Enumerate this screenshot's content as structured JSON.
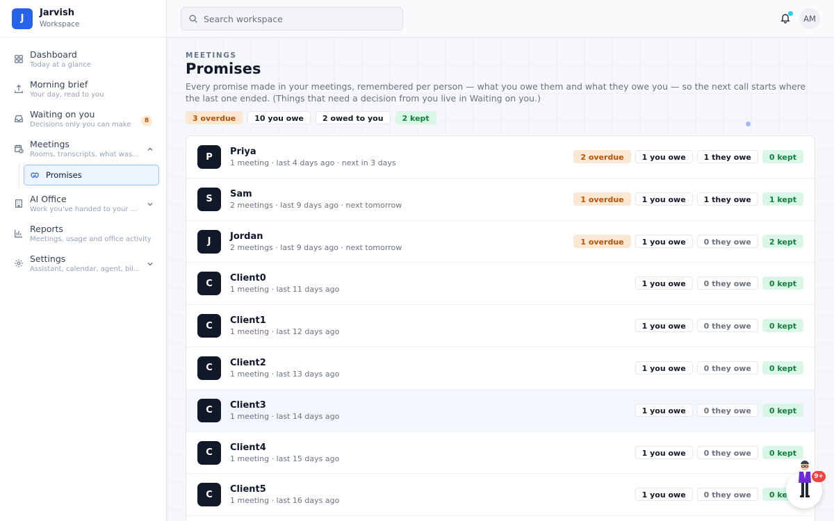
{
  "brand": {
    "initial": "J",
    "name": "Jarvish",
    "subtitle": "Workspace"
  },
  "sidebar": {
    "items": [
      {
        "label": "Dashboard",
        "sub": "Today at a glance",
        "icon": "grid-icon"
      },
      {
        "label": "Morning brief",
        "sub": "Your day, read to you",
        "icon": "upload-icon"
      },
      {
        "label": "Waiting on you",
        "sub": "Decisions only you can make",
        "icon": "inbox-icon",
        "badge": "8"
      },
      {
        "label": "Meetings",
        "sub": "Rooms, transcripts, what was...",
        "icon": "calendar-clock-icon",
        "expanded": true,
        "children": [
          {
            "label": "Promises",
            "icon": "handshake-icon",
            "active": true
          }
        ]
      },
      {
        "label": "AI Office",
        "sub": "Work you've handed to your ...",
        "icon": "building-icon"
      },
      {
        "label": "Reports",
        "sub": "Meetings, usage and office activity",
        "icon": "bar-chart-icon"
      },
      {
        "label": "Settings",
        "sub": "Assistant, calendar, agent, bil...",
        "icon": "gear-icon"
      }
    ]
  },
  "header": {
    "search_placeholder": "Search workspace",
    "avatar_initials": "AM"
  },
  "page": {
    "eyebrow": "MEETINGS",
    "title": "Promises",
    "description": "Every promise made in your meetings, remembered per person — what you owe them and what they owe you — so the next call starts where the last one ended. (Things that need a decision from you live in Waiting on you.)",
    "summary": {
      "overdue": "3 overdue",
      "you_owe": "10 you owe",
      "owed_to_you": "2 owed to you",
      "kept": "2 kept"
    }
  },
  "people": [
    {
      "initial": "P",
      "name": "Priya",
      "meta": "1 meeting · last 4 days ago · next in 3 days",
      "overdue": "2 overdue",
      "you_owe": "1 you owe",
      "they_owe": "1 they owe",
      "kept": "0 kept"
    },
    {
      "initial": "S",
      "name": "Sam",
      "meta": "2 meetings · last 9 days ago · next tomorrow",
      "overdue": "1 overdue",
      "you_owe": "1 you owe",
      "they_owe": "1 they owe",
      "kept": "1 kept"
    },
    {
      "initial": "J",
      "name": "Jordan",
      "meta": "2 meetings · last 9 days ago · next tomorrow",
      "overdue": "1 overdue",
      "you_owe": "1 you owe",
      "they_owe": "0 they owe",
      "kept": "2 kept"
    },
    {
      "initial": "C",
      "name": "Client0",
      "meta": "1 meeting · last 11 days ago",
      "you_owe": "1 you owe",
      "they_owe": "0 they owe",
      "kept": "0 kept"
    },
    {
      "initial": "C",
      "name": "Client1",
      "meta": "1 meeting · last 12 days ago",
      "you_owe": "1 you owe",
      "they_owe": "0 they owe",
      "kept": "0 kept"
    },
    {
      "initial": "C",
      "name": "Client2",
      "meta": "1 meeting · last 13 days ago",
      "you_owe": "1 you owe",
      "they_owe": "0 they owe",
      "kept": "0 kept"
    },
    {
      "initial": "C",
      "name": "Client3",
      "meta": "1 meeting · last 14 days ago",
      "you_owe": "1 you owe",
      "they_owe": "0 they owe",
      "kept": "0 kept",
      "highlight": true
    },
    {
      "initial": "C",
      "name": "Client4",
      "meta": "1 meeting · last 15 days ago",
      "you_owe": "1 you owe",
      "they_owe": "0 they owe",
      "kept": "0 kept"
    },
    {
      "initial": "C",
      "name": "Client5",
      "meta": "1 meeting · last 16 days ago",
      "you_owe": "1 you owe",
      "they_owe": "0 they owe",
      "kept": "0 kept"
    }
  ],
  "assistant": {
    "badge": "9+"
  },
  "colors": {
    "accent": "#2563eb",
    "overdue_bg": "#fbe7d2",
    "overdue_text": "#b45309",
    "kept_bg": "#d9f6e7",
    "kept_text": "#15803d",
    "avatar_bg": "#111827"
  }
}
